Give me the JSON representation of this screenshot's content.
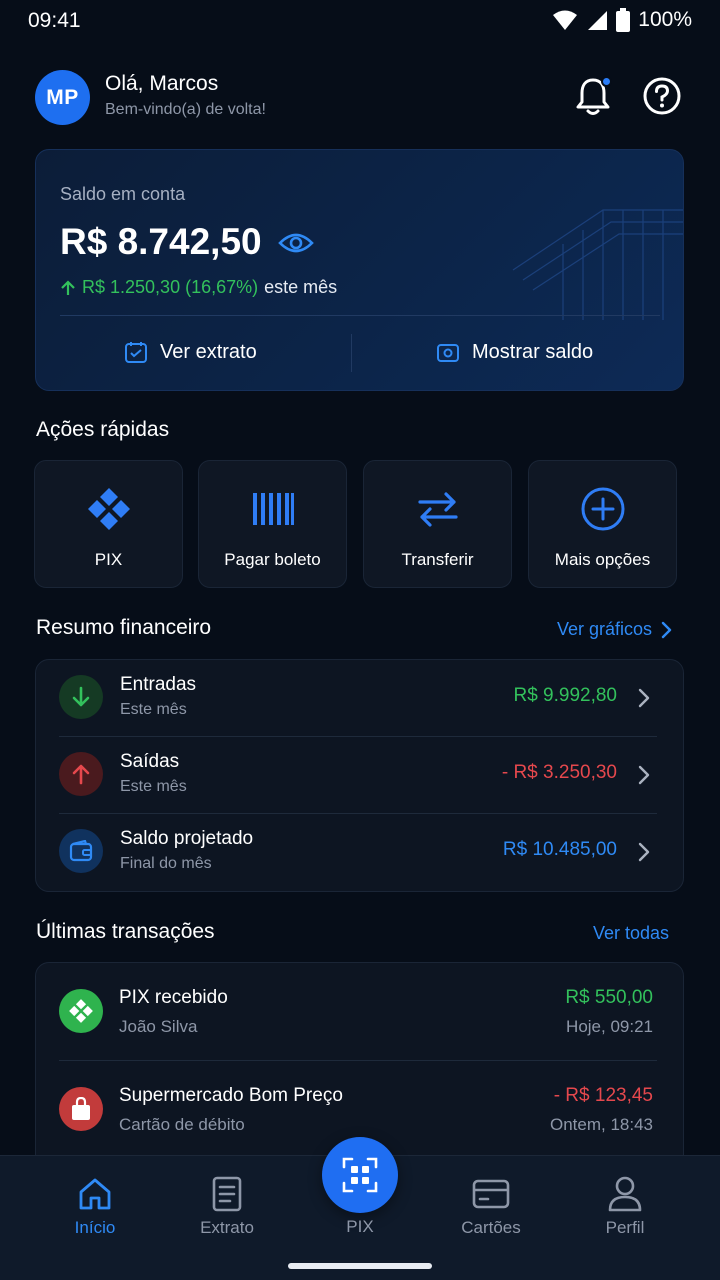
{
  "status_bar": {
    "time": "09:41",
    "battery": "100%"
  },
  "header": {
    "avatar_initials": "MP",
    "greeting": "Olá, Marcos",
    "welcome": "Bem-vindo(a) de volta!"
  },
  "balance": {
    "label": "Saldo em conta",
    "value": "R$ 8.742,50",
    "change": "R$ 1.250,30 (16,67%)",
    "change_suffix": "este mês",
    "actions": {
      "statement": "Ver extrato",
      "show_balance": "Mostrar saldo"
    }
  },
  "quick_actions": {
    "title": "Ações rápidas",
    "items": [
      {
        "label": "PIX",
        "icon": "pix-icon"
      },
      {
        "label": "Pagar boleto",
        "icon": "barcode-icon"
      },
      {
        "label": "Transferir",
        "icon": "transfer-icon"
      },
      {
        "label": "Mais opções",
        "icon": "plus-circle-icon"
      }
    ]
  },
  "summary": {
    "title": "Resumo financeiro",
    "link": "Ver gráficos",
    "rows": [
      {
        "title": "Entradas",
        "subtitle": "Este mês",
        "value": "R$ 9.992,80",
        "color": "#33c15c",
        "icon": "arrow-down-icon"
      },
      {
        "title": "Saídas",
        "subtitle": "Este mês",
        "value": "- R$ 3.250,30",
        "color": "#e5484d",
        "icon": "arrow-up-icon"
      },
      {
        "title": "Saldo projetado",
        "subtitle": "Final do mês",
        "value": "R$ 10.485,00",
        "color": "#2f8af5",
        "icon": "wallet-icon"
      }
    ]
  },
  "transactions": {
    "title": "Últimas transações",
    "link": "Ver todas",
    "items": [
      {
        "title": "PIX recebido",
        "subtitle": "João Silva",
        "amount": "R$ 550,00",
        "time": "Hoje, 09:21",
        "color": "#33c15c",
        "icon": "pix-icon"
      },
      {
        "title": "Supermercado Bom Preço",
        "subtitle": "Cartão de débito",
        "amount": "- R$ 123,45",
        "time": "Ontem, 18:43",
        "color": "#e5484d",
        "icon": "shopping-bag-icon"
      }
    ]
  },
  "bottom_nav": {
    "items": [
      {
        "label": "Início",
        "icon": "home-icon",
        "active": true
      },
      {
        "label": "Extrato",
        "icon": "document-icon",
        "active": false
      },
      {
        "label": "PIX",
        "icon": "qr-scan-icon",
        "active": false
      },
      {
        "label": "Cartões",
        "icon": "card-icon",
        "active": false
      },
      {
        "label": "Perfil",
        "icon": "user-icon",
        "active": false
      }
    ]
  },
  "colors": {
    "accent": "#1f6ef2",
    "positive": "#33c15c",
    "negative": "#e5484d",
    "background": "#060d18"
  }
}
